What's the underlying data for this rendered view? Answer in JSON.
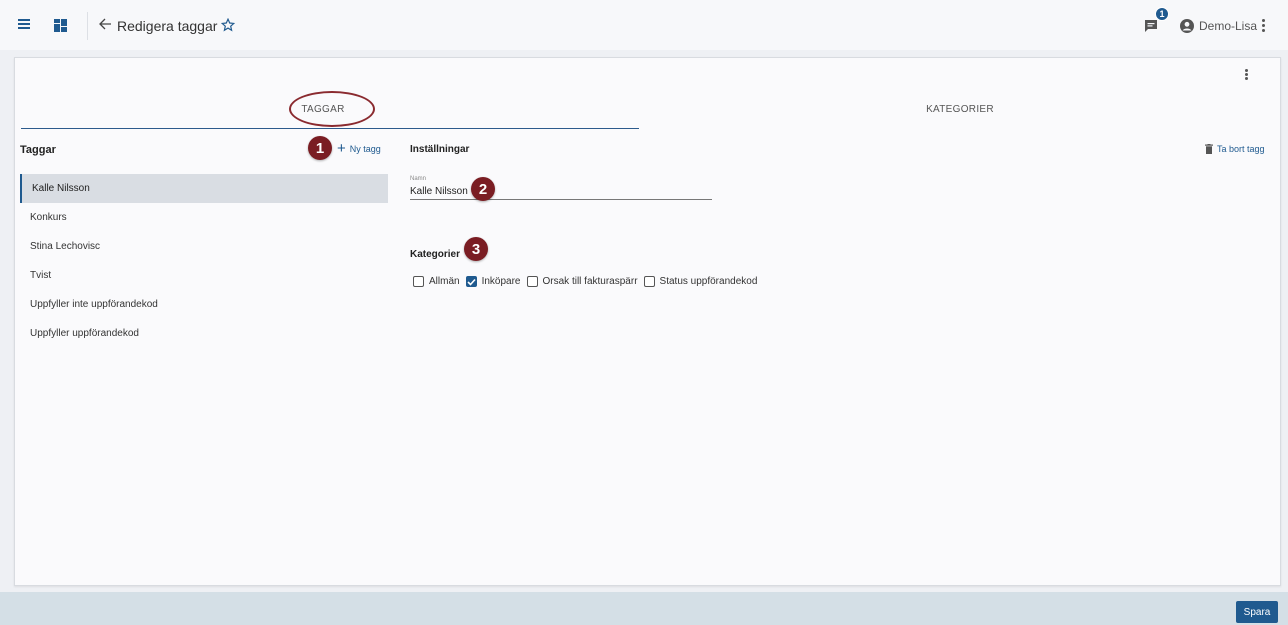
{
  "header": {
    "title": "Redigera taggar",
    "chat_badge": "1",
    "user_name": "Demo-Lisa",
    "icons": [
      "menu-icon",
      "dashboard-icon",
      "back-arrow-icon",
      "star-icon",
      "chat-icon",
      "user-circle-icon",
      "kebab-icon"
    ]
  },
  "tabs": [
    {
      "label": "TAGGAR",
      "active": true
    },
    {
      "label": "KATEGORIER",
      "active": false
    }
  ],
  "tag_panel": {
    "title": "Taggar",
    "new_tag_label": "Ny tagg",
    "items": [
      {
        "label": "Kalle Nilsson",
        "selected": true
      },
      {
        "label": "Konkurs"
      },
      {
        "label": "Stina Lechovisc"
      },
      {
        "label": "Tvist"
      },
      {
        "label": "Uppfyller inte uppförandekod"
      },
      {
        "label": "Uppfyller uppförandekod"
      }
    ]
  },
  "settings": {
    "title": "Inställningar",
    "delete_label": "Ta bort tagg",
    "name_label": "Namn",
    "name_value": "Kalle Nilsson",
    "categories_title": "Kategorier",
    "categories": [
      {
        "label": "Allmän",
        "checked": false
      },
      {
        "label": "Inköpare",
        "checked": true
      },
      {
        "label": "Orsak till fakturaspärr",
        "checked": false
      },
      {
        "label": "Status uppförandekod",
        "checked": false
      }
    ]
  },
  "markers": [
    "1",
    "2",
    "3"
  ],
  "footer": {
    "save_label": "Spara"
  },
  "colors": {
    "accent": "#1f5a8f",
    "marker": "#7a1d23"
  }
}
